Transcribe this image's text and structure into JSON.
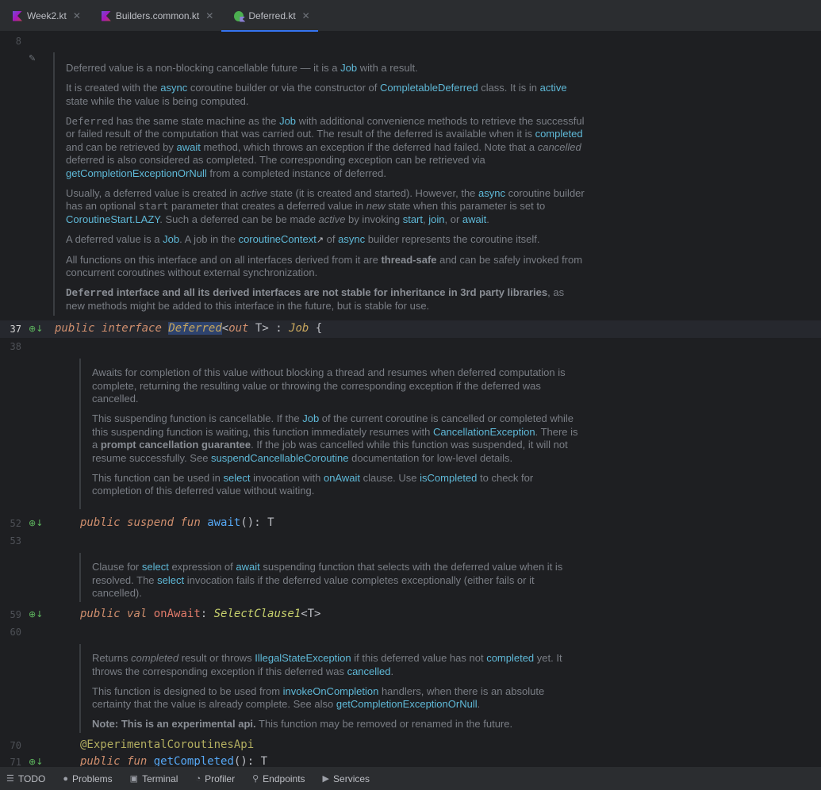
{
  "tabs": [
    {
      "label": "Week2.kt",
      "active": false,
      "icon": "kotlin-file-icon"
    },
    {
      "label": "Builders.common.kt",
      "active": false,
      "icon": "kotlin-file-icon"
    },
    {
      "label": "Deferred.kt",
      "active": true,
      "icon": "kotlin-class-icon"
    }
  ],
  "tab_close": "✕",
  "lines": {
    "l8": "8",
    "l37": "37",
    "l38": "38",
    "l52": "52",
    "l53": "53",
    "l59": "59",
    "l60": "60",
    "l70": "70",
    "l71": "71"
  },
  "code": {
    "interface_line": {
      "kw1": "public",
      "kw2": "interface",
      "name": "Deferred",
      "rest1": "<",
      "kw3": "out",
      "rest2": " T> : ",
      "super": "Job",
      "rest3": " {"
    },
    "await_line": {
      "kw1": "public",
      "kw2": "suspend",
      "kw3": "fun",
      "name": "await",
      "rest": "(): T"
    },
    "onawait_line": {
      "kw1": "public",
      "kw2": "val",
      "name": "onAwait",
      "rest1": ": ",
      "type": "SelectClause1",
      "rest2": "<T>"
    },
    "anno_line": "@ExperimentalCoroutinesApi",
    "getcompleted_line": {
      "kw1": "public",
      "kw2": "fun",
      "name": "getCompleted",
      "rest": "(): T"
    }
  },
  "doc1": {
    "p1": {
      "a": "Deferred value is a non-blocking cancellable future — it is a ",
      "link": "Job",
      "b": " with a result."
    },
    "p2": {
      "a": "It is created with the ",
      "l1": "async",
      "b": " coroutine builder or via the constructor of ",
      "l2": "CompletableDeferred",
      "c": " class. It is in ",
      "l3": "active",
      "d": " state while the value is being computed."
    },
    "p3": {
      "m": "Deferred",
      "a": " has the same state machine as the ",
      "l1": "Job",
      "b": " with additional convenience methods to retrieve the successful or failed result of the computation that was carried out. The result of the deferred is available when it is ",
      "l2": "completed",
      "c": " and can be retrieved by ",
      "l3": "await",
      "d": " method, which throws an exception if the deferred had failed. Note that a ",
      "i": "cancelled",
      "e": " deferred is also considered as completed. The corresponding exception can be retrieved via ",
      "l4": "getCompletionExceptionOrNull",
      "f": " from a completed instance of deferred."
    },
    "p4": {
      "a": "Usually, a deferred value is created in ",
      "i1": "active",
      "b": " state (it is created and started). However, the ",
      "l1": "async",
      "c": " coroutine builder has an optional ",
      "m": "start",
      "d": " parameter that creates a deferred value in ",
      "i2": "new",
      "e": " state when this parameter is set to ",
      "l2": "CoroutineStart.LAZY",
      "f": ". Such a deferred can be be made ",
      "i3": "active",
      "g": " by invoking ",
      "l3": "start",
      "h": ", ",
      "l4": "join",
      "j": ", or ",
      "l5": "await",
      "k": "."
    },
    "p5": {
      "a": "A deferred value is a ",
      "l1": "Job",
      "b": ". A job in the ",
      "l2": "coroutineContext",
      "ext": "↗",
      "c": " of ",
      "l3": "async",
      "d": " builder represents the coroutine itself."
    },
    "p6": {
      "a": "All functions on this interface and on all interfaces derived from it are ",
      "bold": "thread-safe",
      "b": " and can be safely invoked from concurrent coroutines without external synchronization."
    },
    "p7": {
      "m": "Deferred",
      "bold": " interface and all its derived interfaces are not stable for inheritance in 3rd party libraries",
      "a": ", as new methods might be added to this interface in the future, but is stable for use."
    }
  },
  "doc2": {
    "p1": "Awaits for completion of this value without blocking a thread and resumes when deferred computation is complete, returning the resulting value or throwing the corresponding exception if the deferred was cancelled.",
    "p2": {
      "a": "This suspending function is cancellable. If the ",
      "l1": "Job",
      "b": " of the current coroutine is cancelled or completed while this suspending function is waiting, this function immediately resumes with ",
      "l2": "CancellationException",
      "c": ". There is a ",
      "bold": "prompt cancellation guarantee",
      "d": ". If the job was cancelled while this function was suspended, it will not resume successfully. See ",
      "l3": "suspendCancellableCoroutine",
      "e": " documentation for low-level details."
    },
    "p3": {
      "a": "This function can be used in ",
      "l1": "select",
      "b": " invocation with ",
      "l2": "onAwait",
      "c": " clause. Use ",
      "l3": "isCompleted",
      "d": " to check for completion of this deferred value without waiting."
    }
  },
  "doc3": {
    "p1": {
      "a": "Clause for ",
      "l1": "select",
      "b": " expression of ",
      "l2": "await",
      "c": " suspending function that selects with the deferred value when it is resolved. The ",
      "l3": "select",
      "d": " invocation fails if the deferred value completes exceptionally (either fails or it cancelled)."
    }
  },
  "doc4": {
    "p1": {
      "a": "Returns ",
      "i": "completed",
      "b": " result or throws ",
      "l1": "IllegalStateException",
      "c": " if this deferred value has not ",
      "l2": "completed",
      "d": " yet. It throws the corresponding exception if this deferred was ",
      "l3": "cancelled",
      "e": "."
    },
    "p2": {
      "a": "This function is designed to be used from ",
      "l1": "invokeOnCompletion",
      "b": " handlers, when there is an absolute certainty that the value is already complete. See also ",
      "l2": "getCompletionExceptionOrNull",
      "c": "."
    },
    "p3": {
      "bold": "Note: This is an experimental api.",
      "a": " This function may be removed or renamed in the future."
    }
  },
  "gutter_icon": "⊕↓",
  "edit_icon": "✎",
  "toolbar": [
    {
      "label": "TODO",
      "icon": "☰"
    },
    {
      "label": "Problems",
      "icon": "●"
    },
    {
      "label": "Terminal",
      "icon": "▣"
    },
    {
      "label": "Profiler",
      "icon": "◔"
    },
    {
      "label": "Endpoints",
      "icon": "⚲"
    },
    {
      "label": "Services",
      "icon": "▶"
    }
  ]
}
